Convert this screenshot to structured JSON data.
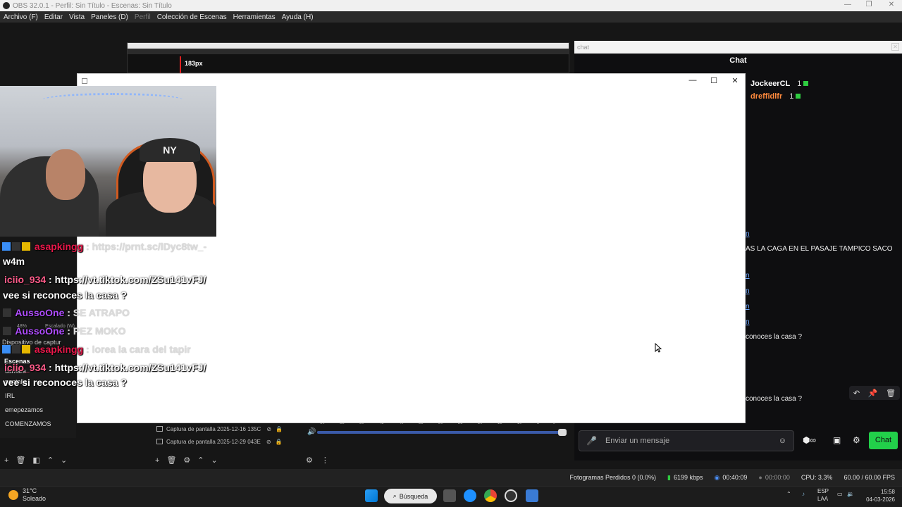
{
  "titlebar": {
    "title": "OBS 32.0.1 - Perfil: Sin Título - Escenas: Sin Título",
    "minimize": "—",
    "maximize": "❐",
    "close": "✕"
  },
  "menu": {
    "items": [
      "Archivo (F)",
      "Editar",
      "Vista",
      "Paneles (D)",
      "Perfil",
      "Colección de Escenas",
      "Herramientas",
      "Ayuda (H)"
    ]
  },
  "preview": {
    "px_label": "183px"
  },
  "chat_dock": {
    "dock_title": "chat",
    "close_label": "✕",
    "header": "Chat",
    "viewers": [
      {
        "name": "JockeerCL",
        "count": "1",
        "color": "#ffffff"
      },
      {
        "name": "dreffidlfr",
        "count": "1",
        "color": "#ff8a3d"
      }
    ],
    "partial_lines": [
      {
        "text": "n",
        "link": true
      },
      {
        "text": "AS LA CAGA EN EL PASAJE TAMPICO SACO",
        "link": false
      },
      {
        "text": "n",
        "link": true
      },
      {
        "text": "n",
        "link": true
      },
      {
        "text": "n",
        "link": true
      },
      {
        "text": "n",
        "link": true
      },
      {
        "text": "conoces la casa ?",
        "link": false
      },
      {
        "text": "conoces la casa ?",
        "link": false
      }
    ],
    "toolbar": {
      "undo": "↶",
      "pin": "📌",
      "trash": "🗑"
    },
    "input_placeholder": "Enviar un mensaje",
    "mic_icon": "🎤",
    "emoji_icon": "☺",
    "send_label": "Chat"
  },
  "scenes": {
    "title": "Escenas",
    "items": [
      "camara",
      "pantalla",
      "IRL",
      "emepezamos",
      "COMENZAMOS"
    ]
  },
  "sources": {
    "items": [
      "Captura de pantalla 2025-12-16 135C",
      "Captura de pantalla 2025-12-29 043E"
    ]
  },
  "mixer": {
    "scale": [
      "-60",
      "-55",
      "-50",
      "-45",
      "-40",
      "-35",
      "-30",
      "-25",
      "-20",
      "-15",
      "-10",
      "-5",
      "0"
    ]
  },
  "capture_device_label": "Dispositivo de captur",
  "zoom_text": "48%",
  "scaling_text": "Escalado (W)",
  "statusbar": {
    "dropped": "Fotogramas Perdidos 0 (0.0%)",
    "bitrate": "6199 kbps",
    "live_time": "00:40:09",
    "rec_time": "00:00:00",
    "cpu": "CPU: 3.3%",
    "fps": "60.00 / 60.00 FPS"
  },
  "taskbar": {
    "temp": "31°C",
    "weather": "Soleado",
    "search": "Búsqueda",
    "lang1": "ESP",
    "lang2": "LAA",
    "time": "15:58",
    "date": "04-03-2026"
  },
  "overlay_chat": [
    {
      "user": "asapkingg",
      "user_color": "#e8184a",
      "badges": [
        "b-blue",
        "b-dark",
        "b-gold"
      ],
      "text": ": https://prnt.sc/lDyc8tw_-",
      "faded": true
    },
    {
      "user": "",
      "user_color": "#ffffff",
      "badges": [],
      "text": "w4m",
      "faded": false
    },
    {
      "user": "iciio_934",
      "user_color": "#ff5c8a",
      "badges": [],
      "text": ": https://vt.tiktok.com/ZSu141vFJ/",
      "faded": false
    },
    {
      "user": "",
      "user_color": "#ffffff",
      "badges": [],
      "text": "vee si reconoces la casa ?",
      "faded": false
    },
    {
      "user": "AussoOne",
      "user_color": "#b04dff",
      "badges": [
        "b-dark"
      ],
      "text": ": SE ATRAPO",
      "faded": false
    },
    {
      "user": "AussoOne",
      "user_color": "#b04dff",
      "badges": [
        "b-dark"
      ],
      "text": ": PEZ MOKO",
      "faded": false
    },
    {
      "user": "asapkingg",
      "user_color": "#e8184a",
      "badges": [
        "b-blue",
        "b-dark",
        "b-gold"
      ],
      "text": ": lorea la cara del tapir",
      "faded": true
    },
    {
      "user": "iciio_934",
      "user_color": "#ff5c8a",
      "badges": [],
      "text": ": https://vt.tiktok.com/ZSu141vFJ/",
      "faded": false
    },
    {
      "user": "",
      "user_color": "#ffffff",
      "badges": [],
      "text": "vee si reconoces la casa ?",
      "faded": false
    }
  ],
  "white_window": {
    "minimize": "—",
    "maximize": "☐",
    "close": "✕"
  },
  "colors": {
    "accent_green": "#22d04a",
    "chat_bg": "#0e0e10"
  }
}
